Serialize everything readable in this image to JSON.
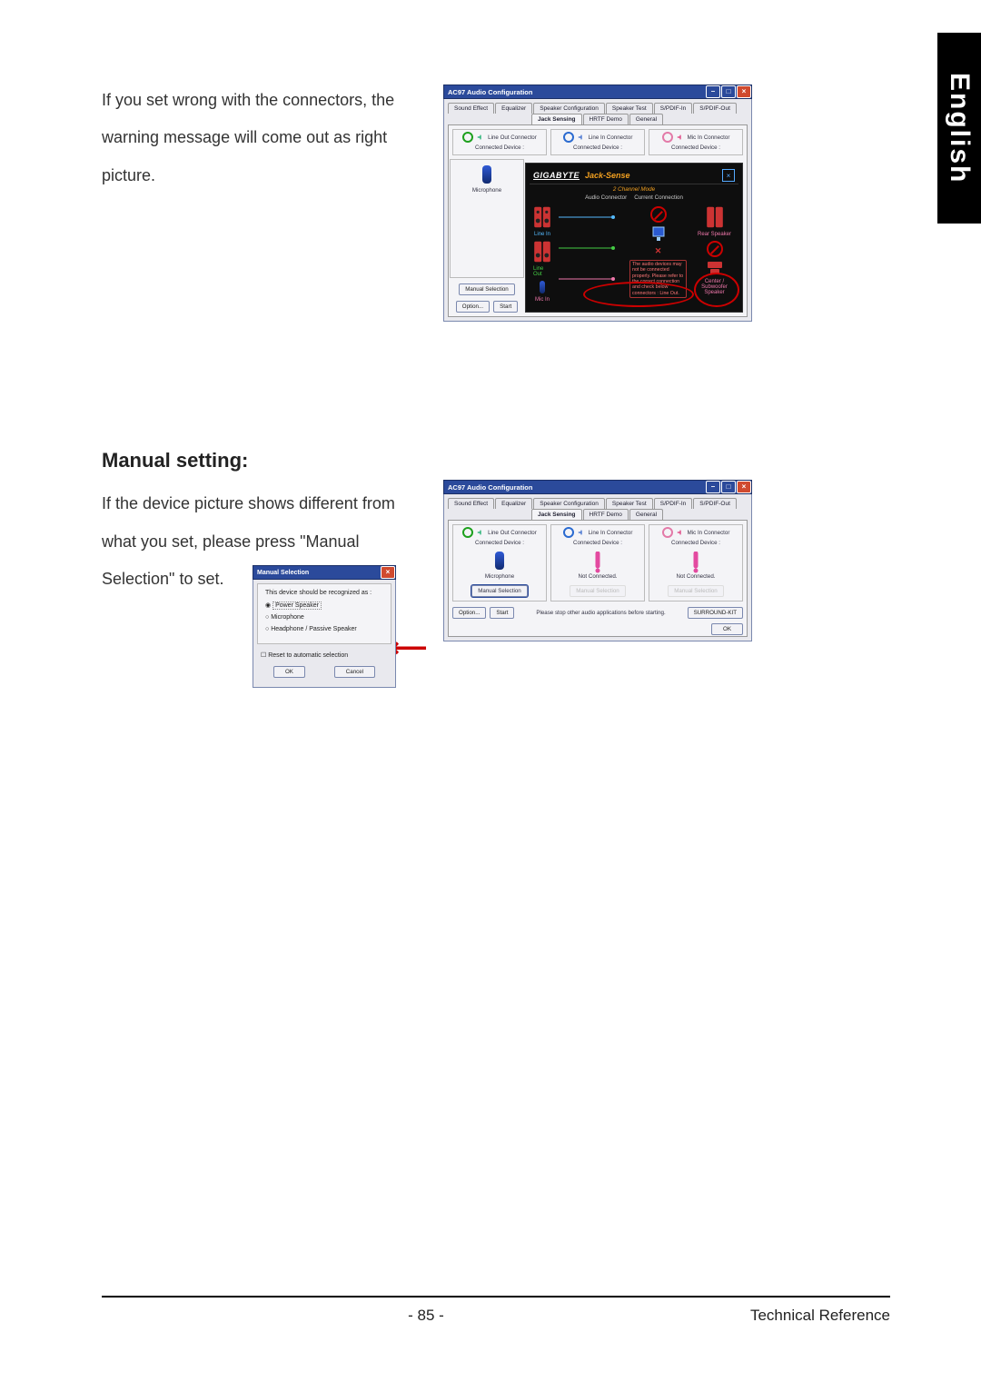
{
  "sideTab": "English",
  "intro1": "If you set wrong with the connectors, the warning message will come out as right picture.",
  "heading": "Manual setting:",
  "intro2": "If the device picture shows different from what you set, please press \"Manual Selection\" to set.",
  "footer": {
    "page": "- 85 -",
    "section": "Technical Reference"
  },
  "win": {
    "title": "AC97 Audio Configuration",
    "min": "–",
    "max": "□",
    "close": "×",
    "tabs": [
      "Sound Effect",
      "Equalizer",
      "Speaker Configuration",
      "Speaker Test",
      "S/PDIF-In",
      "S/PDIF-Out",
      "Jack Sensing",
      "HRTF Demo",
      "General"
    ],
    "activeTab": "Jack Sensing"
  },
  "jacks": {
    "lineOut": "Line Out Connector",
    "lineIn": "Line In Connector",
    "micIn": "Mic In Connector",
    "connected": "Connected Device :"
  },
  "shotA": {
    "device": "Microphone",
    "manualSel": "Manual Selection",
    "option": "Option...",
    "start": "Start"
  },
  "sense": {
    "brand": "GIGABYTE",
    "title": "Jack-Sense",
    "mode": "2 Channel Mode",
    "audioConn": "Audio Connector",
    "curConn": "Current Connection",
    "lineIn": "Line In",
    "lineOut": "Line Out",
    "micIn": "Mic In",
    "rear": "Rear Speaker",
    "csub": "Center / Subwoofer Speaker",
    "warnMsg": "The audio devices may not be connected properly. Please refer to the correct connection and check below connectors : Line Out."
  },
  "shotB": {
    "notConnected": "Not Connected.",
    "microphone": "Microphone",
    "manualSel": "Manual Selection",
    "option": "Option...",
    "start": "Start",
    "note": "Please stop other audio applications before starting.",
    "surround": "SURROUND-KIT",
    "ok": "OK"
  },
  "ms": {
    "title": "Manual Selection",
    "close": "×",
    "prompt": "This device should be recognized as :",
    "opt1": "Power Speaker",
    "opt2": "Microphone",
    "opt3": "Headphone / Passive Speaker",
    "reset": "Reset to automatic selection",
    "ok": "OK",
    "cancel": "Cancel"
  }
}
